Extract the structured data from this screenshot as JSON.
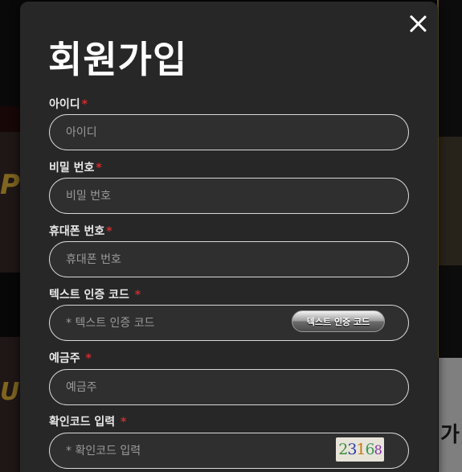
{
  "modal": {
    "title": "회원가입",
    "required_mark": "*"
  },
  "fields": [
    {
      "label": "아이디",
      "placeholder": "아이디",
      "value": ""
    },
    {
      "label": "비밀 번호",
      "placeholder": "비밀 번호",
      "value": ""
    },
    {
      "label": "휴대폰 번호",
      "placeholder": "휴대폰 번호",
      "value": ""
    },
    {
      "label": "텍스트 인증 코드",
      "placeholder": "* 텍스트 인증 코드",
      "value": ""
    },
    {
      "label": "예금주",
      "placeholder": "예금주",
      "value": ""
    },
    {
      "label": "확인코드 입력",
      "placeholder": "* 확인코드 입력",
      "value": ""
    }
  ],
  "text_code_button": "텍스트 인증 코드",
  "captcha": [
    "2",
    "3",
    "1",
    "6",
    "8"
  ],
  "background": {
    "right_text": "가",
    "left_logo_1": "P",
    "left_logo_2": "UB"
  }
}
